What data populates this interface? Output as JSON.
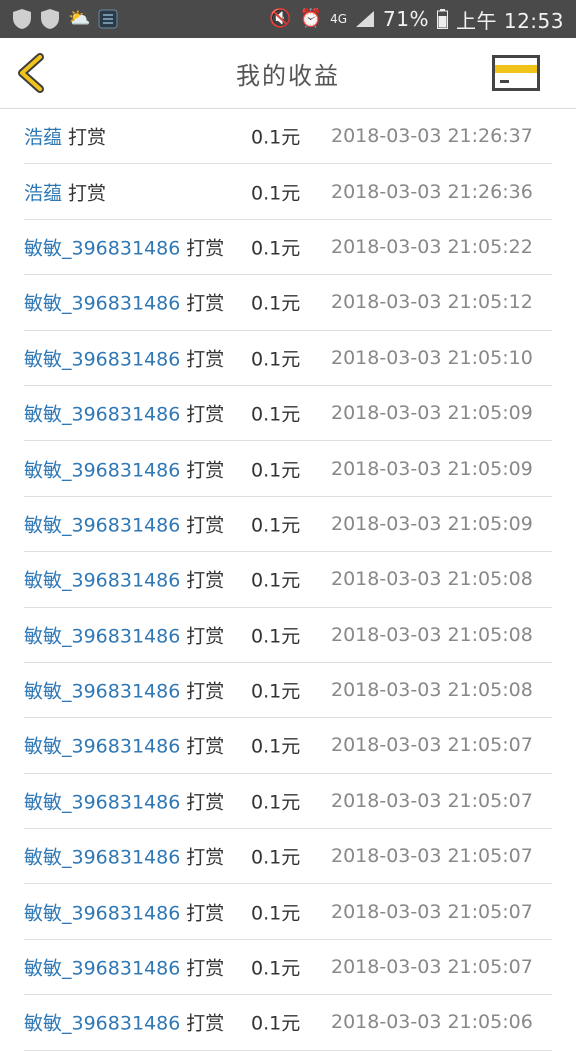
{
  "status_bar": {
    "battery": "71%",
    "time": "上午 12:53",
    "network": "4G",
    "icons": [
      "shield-icon",
      "shield-icon",
      "weather-icon",
      "app-icon",
      "mute-icon",
      "alarm-icon",
      "network-4g-icon",
      "signal-icon",
      "battery-icon"
    ]
  },
  "header": {
    "title": "我的收益",
    "back_icon": "chevron-left-icon",
    "card_icon": "card-icon"
  },
  "colors": {
    "accent": "#f0c419",
    "name_link": "#2f78b5",
    "time_text": "#888888"
  },
  "list": {
    "action": "打赏",
    "items": [
      {
        "name": "浩蕴",
        "amount": "0.1元",
        "time": "2018-03-03 21:26:37"
      },
      {
        "name": "浩蕴",
        "amount": "0.1元",
        "time": "2018-03-03 21:26:36"
      },
      {
        "name": "敏敏_396831486",
        "amount": "0.1元",
        "time": "2018-03-03 21:05:22"
      },
      {
        "name": "敏敏_396831486",
        "amount": "0.1元",
        "time": "2018-03-03 21:05:12"
      },
      {
        "name": "敏敏_396831486",
        "amount": "0.1元",
        "time": "2018-03-03 21:05:10"
      },
      {
        "name": "敏敏_396831486",
        "amount": "0.1元",
        "time": "2018-03-03 21:05:09"
      },
      {
        "name": "敏敏_396831486",
        "amount": "0.1元",
        "time": "2018-03-03 21:05:09"
      },
      {
        "name": "敏敏_396831486",
        "amount": "0.1元",
        "time": "2018-03-03 21:05:09"
      },
      {
        "name": "敏敏_396831486",
        "amount": "0.1元",
        "time": "2018-03-03 21:05:08"
      },
      {
        "name": "敏敏_396831486",
        "amount": "0.1元",
        "time": "2018-03-03 21:05:08"
      },
      {
        "name": "敏敏_396831486",
        "amount": "0.1元",
        "time": "2018-03-03 21:05:08"
      },
      {
        "name": "敏敏_396831486",
        "amount": "0.1元",
        "time": "2018-03-03 21:05:07"
      },
      {
        "name": "敏敏_396831486",
        "amount": "0.1元",
        "time": "2018-03-03 21:05:07"
      },
      {
        "name": "敏敏_396831486",
        "amount": "0.1元",
        "time": "2018-03-03 21:05:07"
      },
      {
        "name": "敏敏_396831486",
        "amount": "0.1元",
        "time": "2018-03-03 21:05:07"
      },
      {
        "name": "敏敏_396831486",
        "amount": "0.1元",
        "time": "2018-03-03 21:05:07"
      },
      {
        "name": "敏敏_396831486",
        "amount": "0.1元",
        "time": "2018-03-03 21:05:06"
      }
    ]
  }
}
